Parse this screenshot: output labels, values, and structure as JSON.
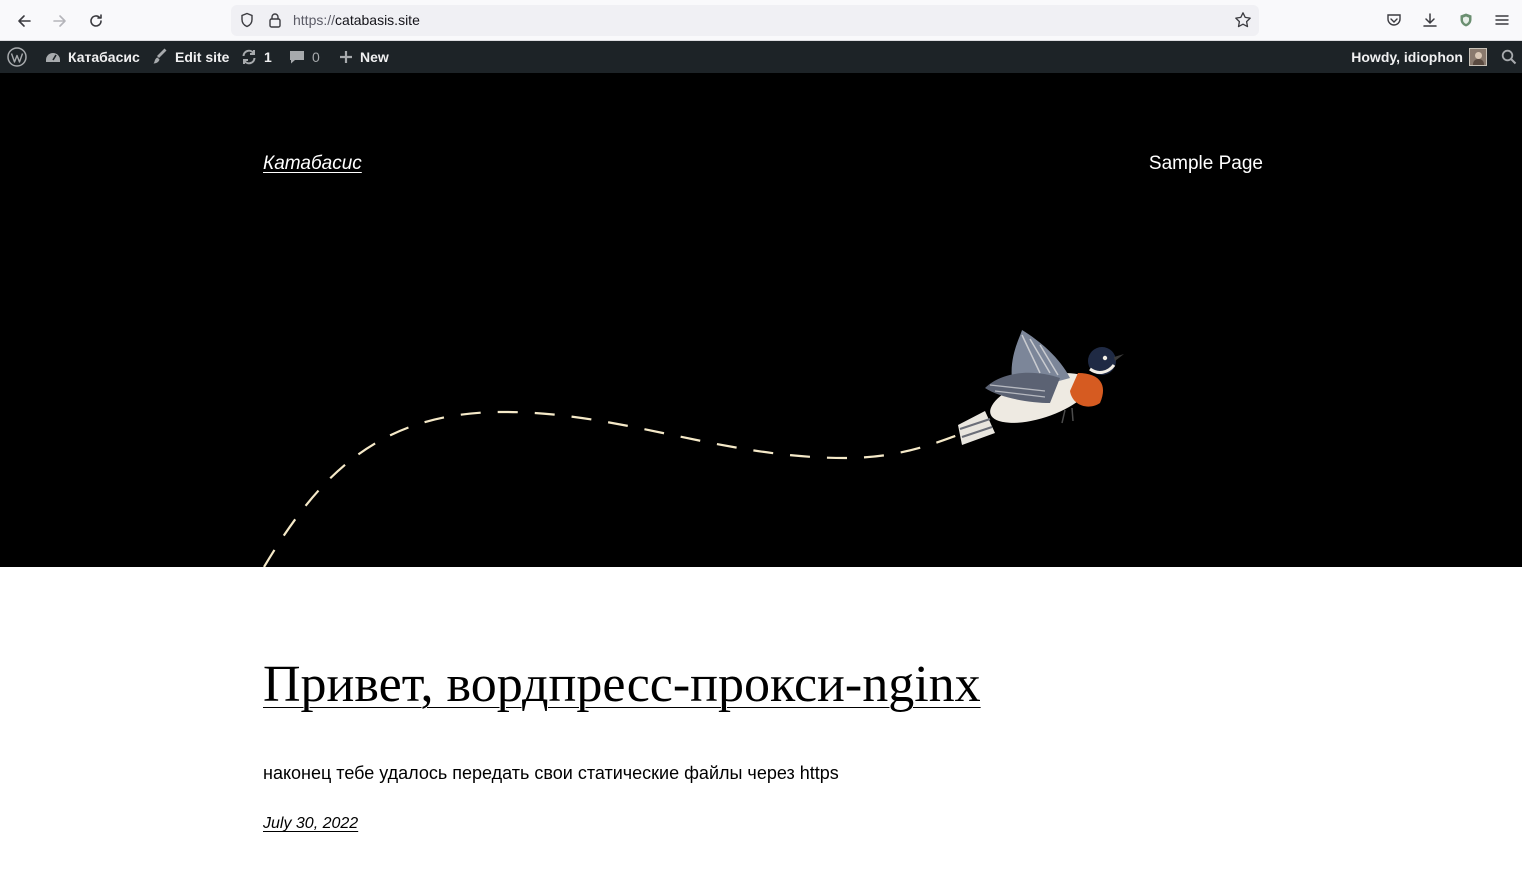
{
  "browser": {
    "url_scheme": "https://",
    "url_host": "catabasis.site",
    "icons": [
      "back-icon",
      "forward-icon",
      "reload-icon",
      "shield-icon",
      "lock-icon",
      "star-icon",
      "pocket-icon",
      "download-icon",
      "extension-shield-icon",
      "menu-icon"
    ]
  },
  "adminbar": {
    "site_name": "Катабасис",
    "edit_site": "Edit site",
    "updates_count": "1",
    "comments_count": "0",
    "new_label": "New",
    "howdy": "Howdy, idiophon"
  },
  "hero": {
    "site_title": "Катабасис",
    "nav_items": [
      "Sample Page"
    ],
    "background": "#000000",
    "path_color": "#f5e9c8"
  },
  "post": {
    "title": "Привет, вордпресс-прокси-nginx",
    "excerpt": "наконец тебе удалось передать свои статические файлы через https",
    "date": "July 30, 2022"
  }
}
